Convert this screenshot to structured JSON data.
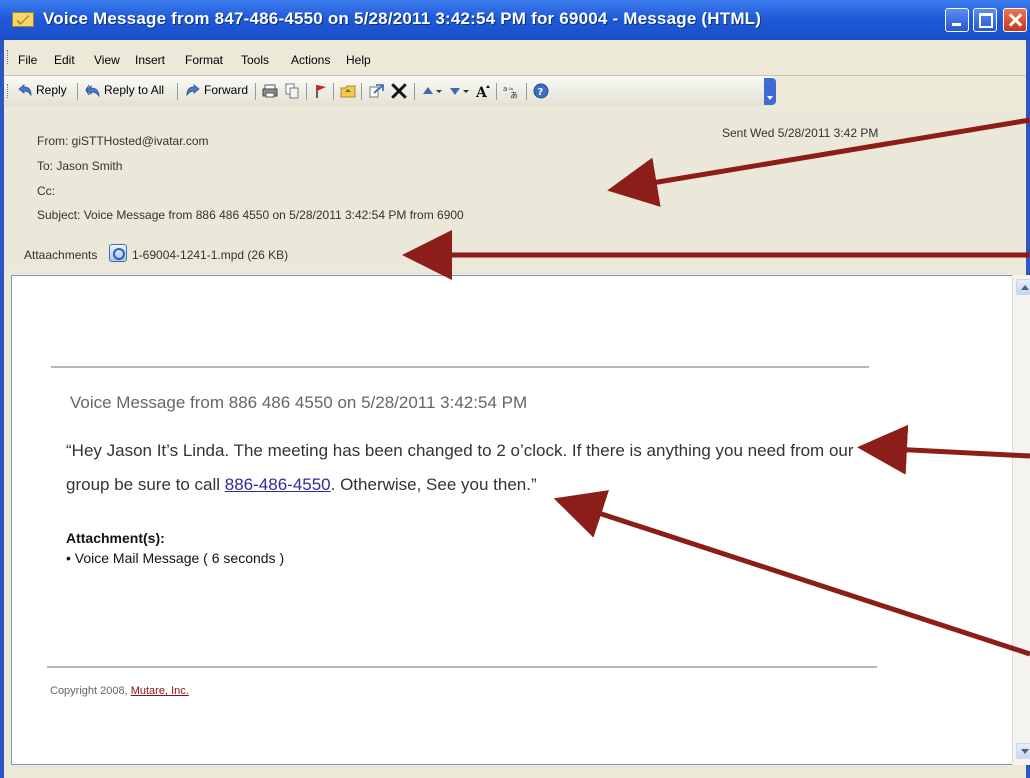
{
  "window": {
    "title": "Voice Message from 847-486-4550 on 5/28/2011  3:42:54 PM for 69004 - Message (HTML)"
  },
  "menu": [
    "File",
    "Edit",
    "View",
    "Insert",
    "Format",
    "Tools",
    "Actions",
    "Help"
  ],
  "toolbar": {
    "reply": "Reply",
    "reply_all": "Reply to All",
    "forward": "Forward",
    "icons": [
      "reply-icon",
      "reply-all-icon",
      "forward-icon",
      "print-icon",
      "copy-icon",
      "flag-icon",
      "folder-icon",
      "move-icon",
      "delete-icon",
      "previous-item-icon",
      "next-item-icon",
      "font-size-icon",
      "translate-icon",
      "help-icon"
    ]
  },
  "header": {
    "from": "From:  giSTTHosted@ivatar.com",
    "to": "To: Jason Smith",
    "cc": "Cc:",
    "subject": "Subject: Voice Message from   886  486 4550  on 5/28/2011  3:42:54 PM from 6900",
    "sent": "Sent Wed 5/28/2011  3:42 PM",
    "attachments_label": "Attaachments",
    "attachment": "1-69004-1241-1.mpd (26 KB)"
  },
  "body": {
    "voice_title": "Voice Message from   886 486 4550 on 5/28/2011   3:42:54 PM",
    "transcript_part1": "“Hey Jason It’s Linda. The meeting has been changed to 2 o’clock. If there is anything you  need from our group be sure to call ",
    "phone_link": "886-486-4550",
    "transcript_part2": ". Otherwise, See you then.”",
    "attachments_heading": "Attachment(s):",
    "attachment_item": "•  Voice Mail Message ( 6 seconds )",
    "copyright_text": "Copyright 2008, ",
    "copyright_link": "Mutare, Inc."
  },
  "colors": {
    "title_bar": "#1f5ad8",
    "header_bg": "#ebe7d9",
    "arrow": "#8c1d18",
    "link": "#2e2e9b"
  }
}
